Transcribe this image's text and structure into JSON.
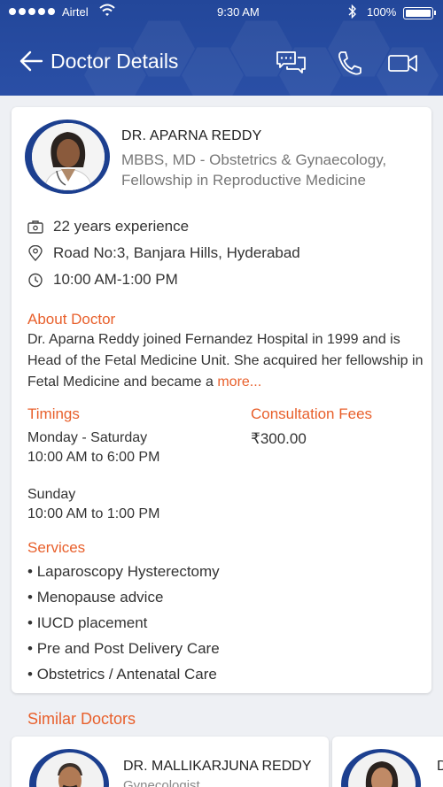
{
  "status_bar": {
    "carrier": "Airtel",
    "time": "9:30 AM",
    "battery": "100%"
  },
  "header": {
    "title": "Doctor Details",
    "icons": [
      "back-arrow-icon",
      "chat-icon",
      "phone-icon",
      "video-icon"
    ]
  },
  "doctor": {
    "name": "DR. APARNA REDDY",
    "qualification": "MBBS, MD - Obstetrics & Gynaecology, Fellowship in Reproductive Medicine",
    "experience": "22 years experience",
    "address": "Road No:3, Banjara Hills, Hyderabad",
    "hours": "10:00 AM-1:00 PM"
  },
  "about": {
    "heading": "About Doctor",
    "text": "Dr. Aparna Reddy joined Fernandez Hospital in 1999 and is Head of the Fetal Medicine Unit. She acquired her fellowship in Fetal Medicine and became a ",
    "more": "more..."
  },
  "timings": {
    "heading": "Timings",
    "slot1_days": "Monday - Saturday",
    "slot1_hours": "10:00 AM to 6:00 PM",
    "slot2_days": "Sunday",
    "slot2_hours": "10:00 AM to 1:00 PM"
  },
  "fees": {
    "heading": "Consultation Fees",
    "amount": "₹300.00"
  },
  "services": {
    "heading": "Services",
    "items": [
      "Laparoscopy Hysterectomy",
      "Menopause advice",
      "IUCD placement",
      "Pre and Post Delivery Care",
      "Obstetrics / Antenatal Care"
    ]
  },
  "similar": {
    "heading": "Similar Doctors",
    "doctors": [
      {
        "name": "DR. MALLIKARJUNA REDDY",
        "specialty": "Gynecologist"
      },
      {
        "name": "D"
      }
    ]
  },
  "colors": {
    "header_blue": "#2a4fa6",
    "accent_orange": "#e8602c"
  }
}
